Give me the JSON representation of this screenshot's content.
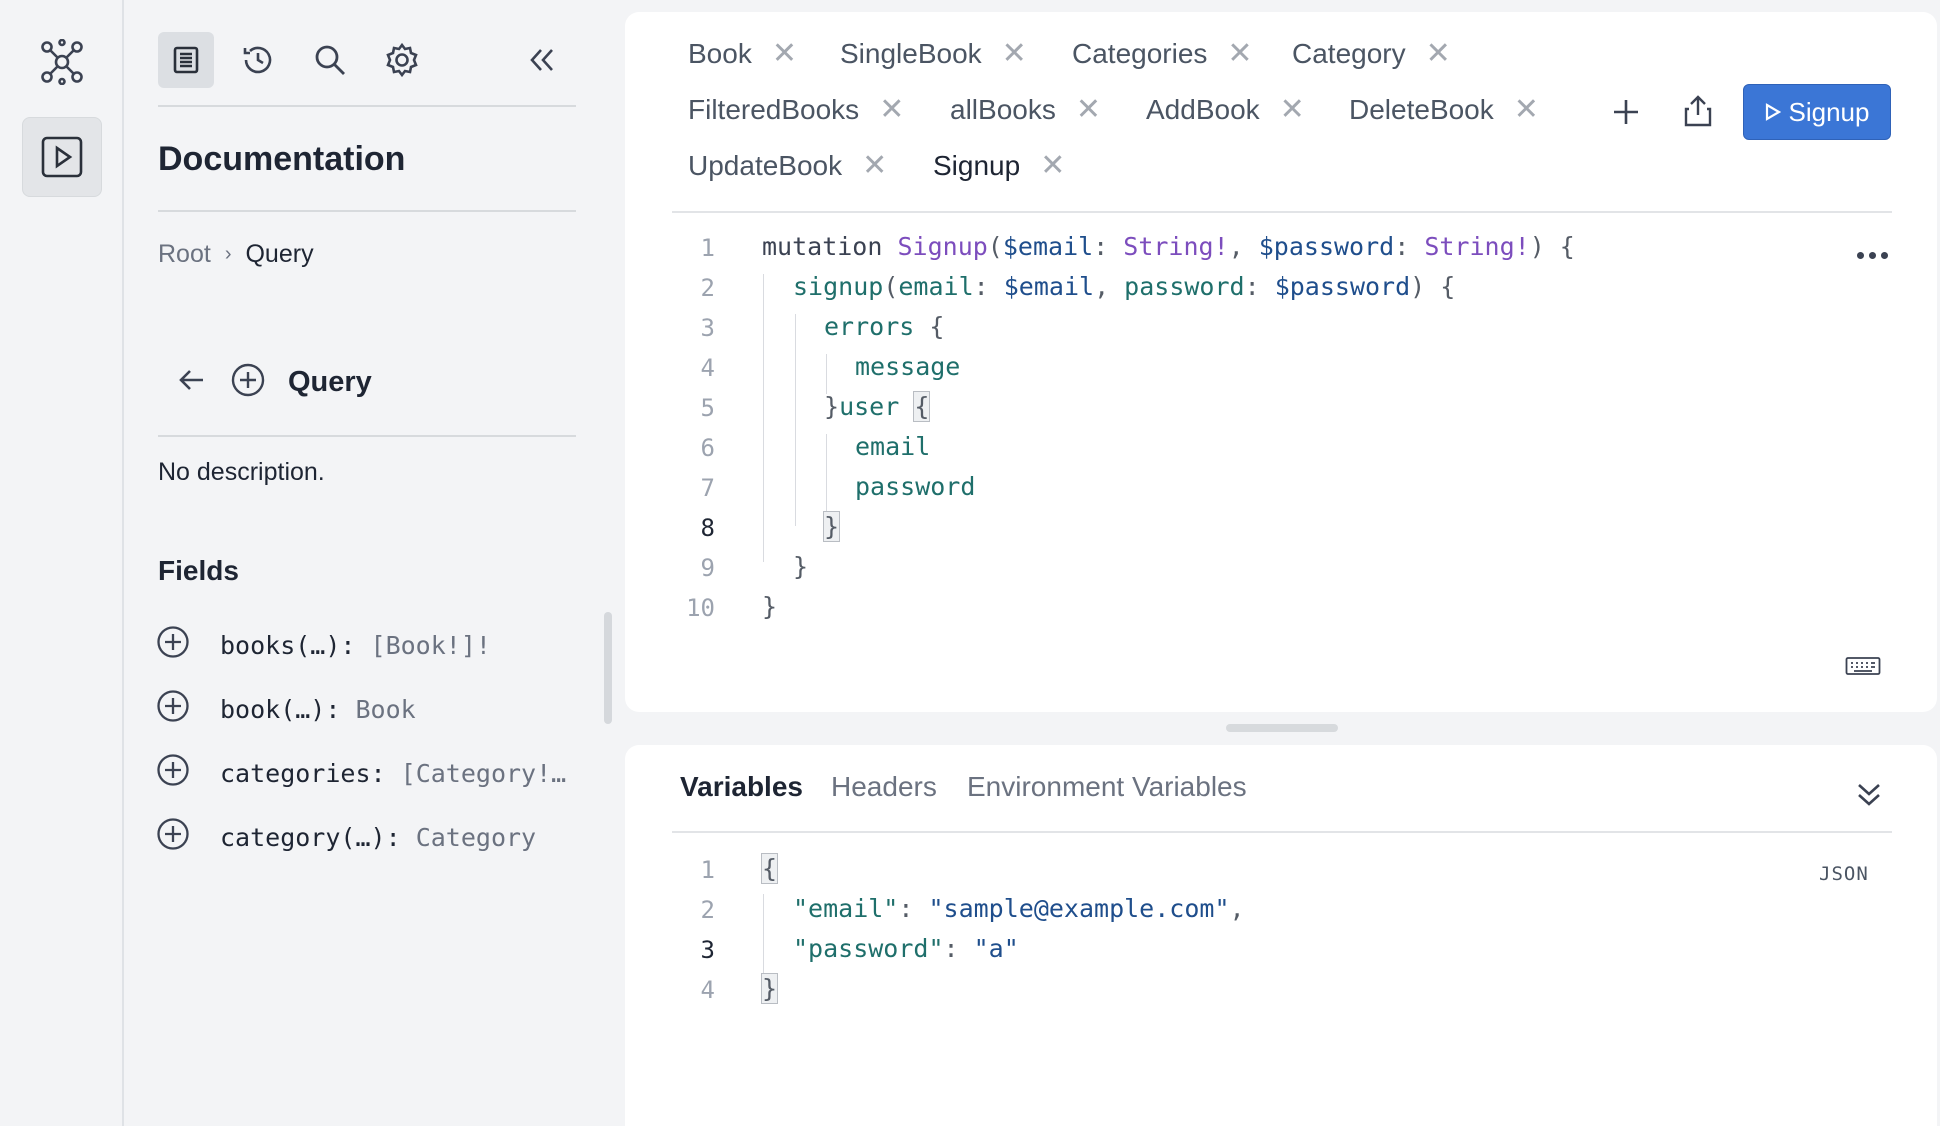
{
  "rail": {
    "logo_icon": "graphql-logo-icon",
    "play_icon": "play-icon"
  },
  "docs": {
    "tools": [
      "docs-icon",
      "history-icon",
      "search-icon",
      "settings-icon"
    ],
    "title": "Documentation",
    "breadcrumb": {
      "root": "Root",
      "current": "Query"
    },
    "section_title": "Query",
    "description": "No description.",
    "fields_title": "Fields",
    "fields": [
      {
        "name": "books(…):",
        "type": "[Book!]!"
      },
      {
        "name": "book(…):",
        "type": "Book"
      },
      {
        "name": "categories:",
        "type": "[Category!…"
      },
      {
        "name": "category(…):",
        "type": "Category"
      }
    ]
  },
  "tabs": [
    {
      "label": "Book"
    },
    {
      "label": "SingleBook"
    },
    {
      "label": "Categories"
    },
    {
      "label": "Category"
    },
    {
      "label": "FilteredBooks"
    },
    {
      "label": "allBooks"
    },
    {
      "label": "AddBook"
    },
    {
      "label": "DeleteBook"
    },
    {
      "label": "UpdateBook"
    },
    {
      "label": "Signup",
      "active": true
    }
  ],
  "tab_close_glyph": "✕",
  "run_button": {
    "label": "Signup"
  },
  "editor": {
    "line_numbers": [
      "1",
      "2",
      "3",
      "4",
      "5",
      "6",
      "7",
      "8",
      "9",
      "10"
    ],
    "current_line": "8",
    "lines": {
      "l1_kw": "mutation",
      "l1_name": "Signup",
      "l1_p1": "(",
      "l1_v1": "$email",
      "l1_c1": ": ",
      "l1_t1": "String!",
      "l1_comma": ", ",
      "l1_v2": "$password",
      "l1_c2": ": ",
      "l1_t2": "String!",
      "l1_end": ") {",
      "l2_fld": "signup",
      "l2_p1": "(",
      "l2_a1": "email",
      "l2_c1": ": ",
      "l2_v1": "$email",
      "l2_comma": ", ",
      "l2_a2": "password",
      "l2_c2": ": ",
      "l2_v2": "$password",
      "l2_end": ") {",
      "l3_fld": "errors",
      "l3_end": " {",
      "l4_fld": "message",
      "l5_close": "}",
      "l5_fld": "user",
      "l5_open": "{",
      "l6_fld": "email",
      "l7_fld": "password",
      "l8_close": "}",
      "l9_close": "}",
      "l10_close": "}"
    }
  },
  "variables_panel": {
    "tabs": [
      "Variables",
      "Headers",
      "Environment Variables"
    ],
    "active_tab": "Variables",
    "format_label": "JSON",
    "line_numbers": [
      "1",
      "2",
      "3",
      "4"
    ],
    "current_line": "3",
    "open_brace": "{",
    "close_brace": "}",
    "entries": [
      {
        "key": "\"email\"",
        "value": "\"sample@example.com\"",
        "trail": ","
      },
      {
        "key": "\"password\"",
        "value": "\"a\"",
        "trail": ""
      }
    ]
  }
}
